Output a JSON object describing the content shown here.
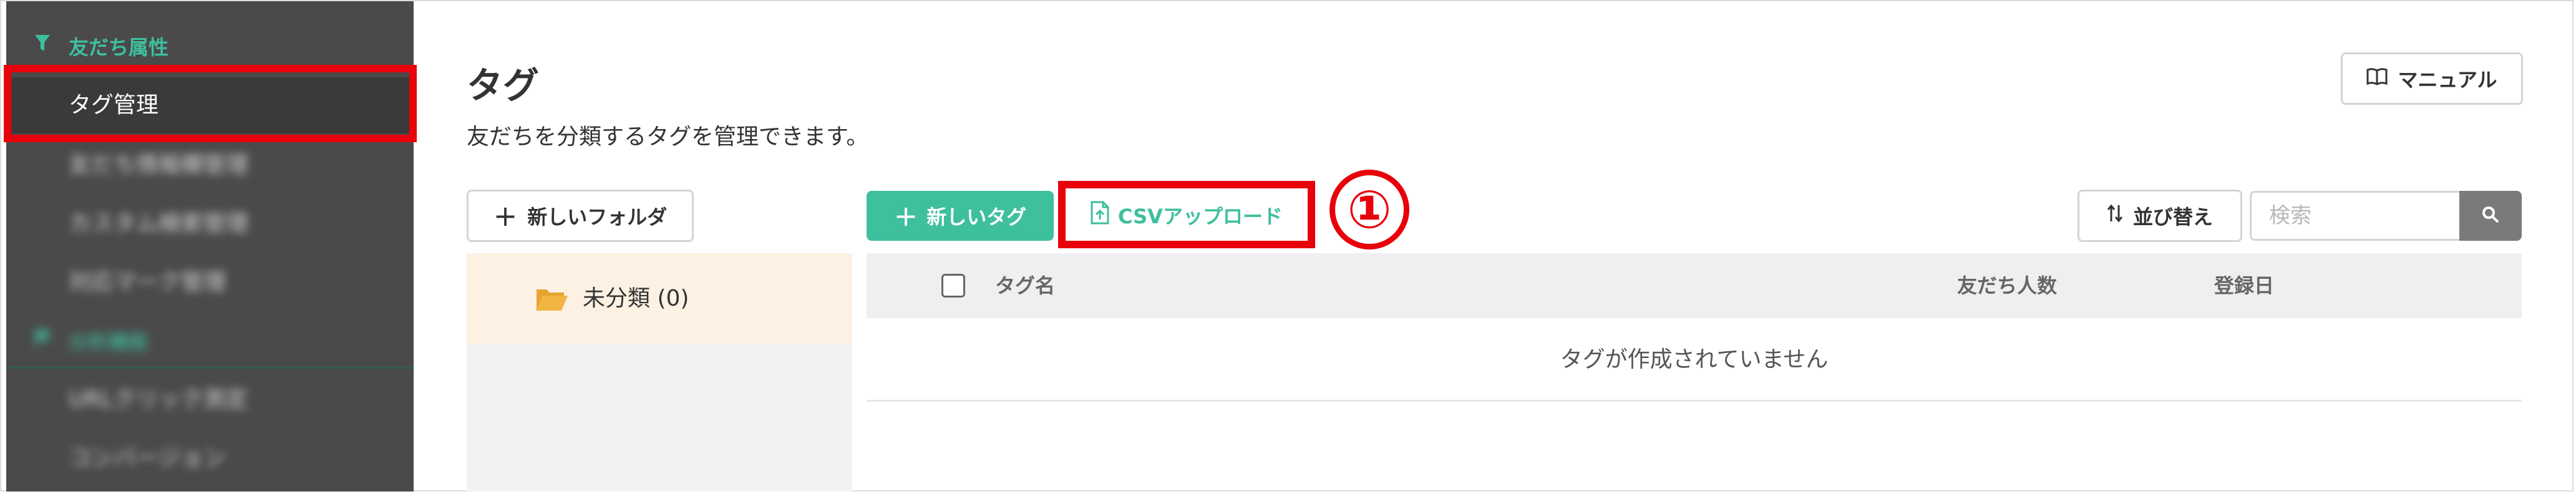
{
  "sidebar": {
    "section_friends": "友だち属性",
    "tag_management": "タグ管理",
    "friend_info_management": "友だち情報欄管理",
    "custom_search_management": "カスタム検索管理",
    "support_mark_management": "対応マーク管理",
    "section_analytics": "分析機能",
    "url_click_measurement": "URLクリック測定",
    "conversion": "コンバージョン"
  },
  "page": {
    "title": "タグ",
    "subtitle": "友だちを分類するタグを管理できます。"
  },
  "toolbar": {
    "manual_label": "マニュアル",
    "new_folder_label": "新しいフォルダ",
    "new_tag_label": "新しいタグ",
    "csv_upload_label": "CSVアップロード",
    "sort_label": "並び替え",
    "search_placeholder": "検索"
  },
  "annotation": {
    "marker": "①"
  },
  "folders": [
    {
      "label": "未分類 (0)"
    }
  ],
  "table": {
    "columns": [
      "タグ名",
      "友だち人数",
      "登録日"
    ],
    "empty_message": "タグが作成されていません"
  },
  "colors": {
    "accent": "#3ebf9e",
    "sidebar_bg": "#4a4a4a",
    "highlight": "#e8000b"
  }
}
